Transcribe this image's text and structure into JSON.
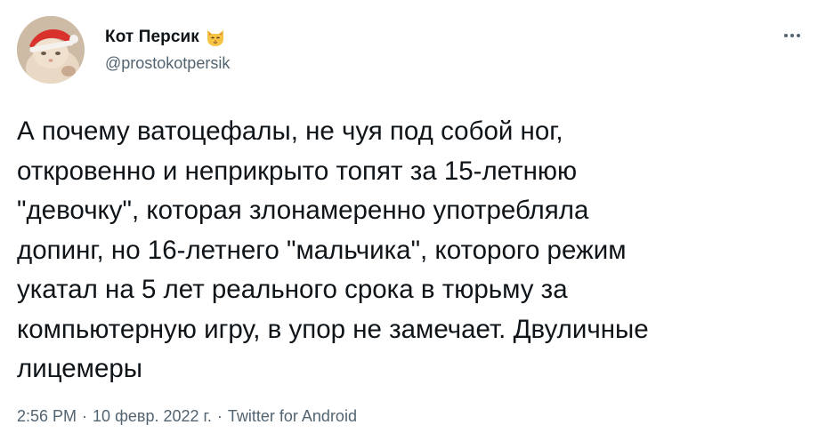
{
  "author": {
    "display_name": "Кот Персик",
    "handle": "@prostokotpersik",
    "name_emoji": "cat-face-emoji"
  },
  "tweet": {
    "text": "А почему ватоцефалы, не чуя под собой ног,\nоткровенно и неприкрыто топят за 15-летнюю\n\"девочку\", которая злонамеренно употребляла\nдопинг, но 16-летнего \"мальчика\", которого режим\nукатал на 5 лет реального срока в тюрьму за\nкомпьютерную игру, в упор не замечает. Двуличные\nлицемеры"
  },
  "meta": {
    "time": "2:56 PM",
    "separator": "·",
    "date": "10 февр. 2022 г.",
    "source": "Twitter for Android"
  },
  "icons": {
    "more": "more-options-icon"
  },
  "colors": {
    "text": "#0f1419",
    "secondary": "#536471",
    "background": "#ffffff"
  }
}
